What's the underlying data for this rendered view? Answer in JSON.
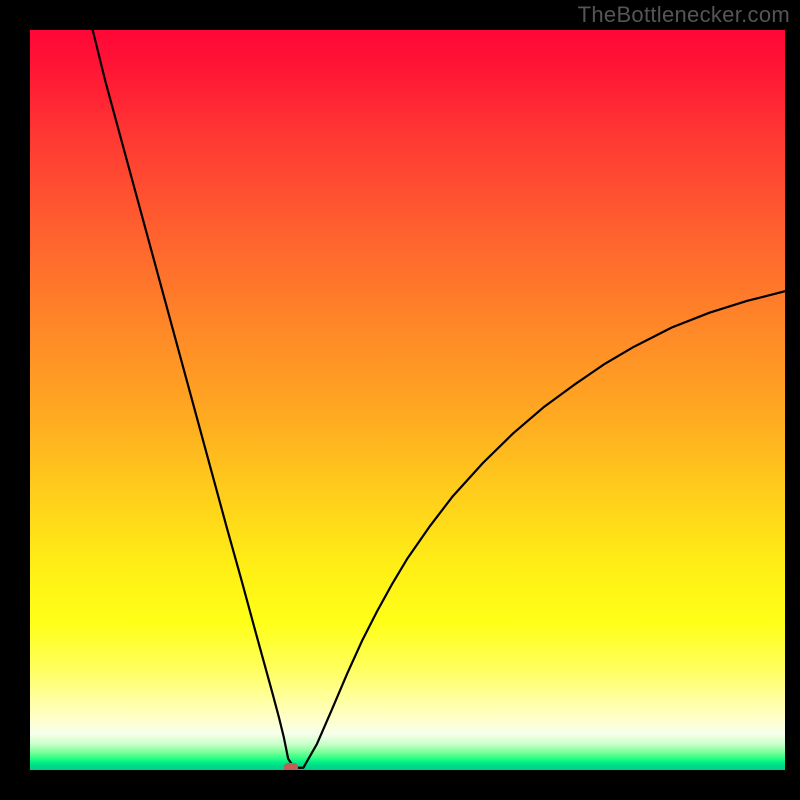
{
  "watermark": "TheBottlenecker.com",
  "chart_data": {
    "type": "line",
    "title": "",
    "xlabel": "",
    "ylabel": "",
    "xlim": [
      0,
      100
    ],
    "ylim": [
      0,
      100
    ],
    "series": [
      {
        "name": "curve",
        "x": [
          8.3,
          10,
          12,
          14,
          16,
          18,
          20,
          22,
          24,
          26,
          28,
          30,
          31,
          32,
          33,
          33.6,
          34.2,
          35,
          36.2,
          38,
          40,
          42,
          44,
          46,
          48,
          50,
          53,
          56,
          60,
          64,
          68,
          72,
          76,
          80,
          85,
          90,
          95,
          100
        ],
        "y": [
          100,
          93,
          85.5,
          78,
          70.5,
          63,
          55.5,
          48,
          40.5,
          33,
          25.7,
          18.2,
          14.5,
          10.8,
          7,
          4.5,
          1.5,
          0.3,
          0.3,
          3.5,
          8.2,
          13,
          17.5,
          21.5,
          25.2,
          28.6,
          33,
          37,
          41.5,
          45.5,
          49,
          52,
          54.8,
          57.2,
          59.8,
          61.8,
          63.4,
          64.7
        ]
      }
    ],
    "marker": {
      "x": 34.6,
      "y": 0.3
    },
    "gradient_stops": [
      {
        "pos": 0,
        "color": "#ff0736"
      },
      {
        "pos": 50,
        "color": "#ffa921"
      },
      {
        "pos": 80,
        "color": "#ffff17"
      },
      {
        "pos": 100,
        "color": "#00cf8a"
      }
    ]
  }
}
